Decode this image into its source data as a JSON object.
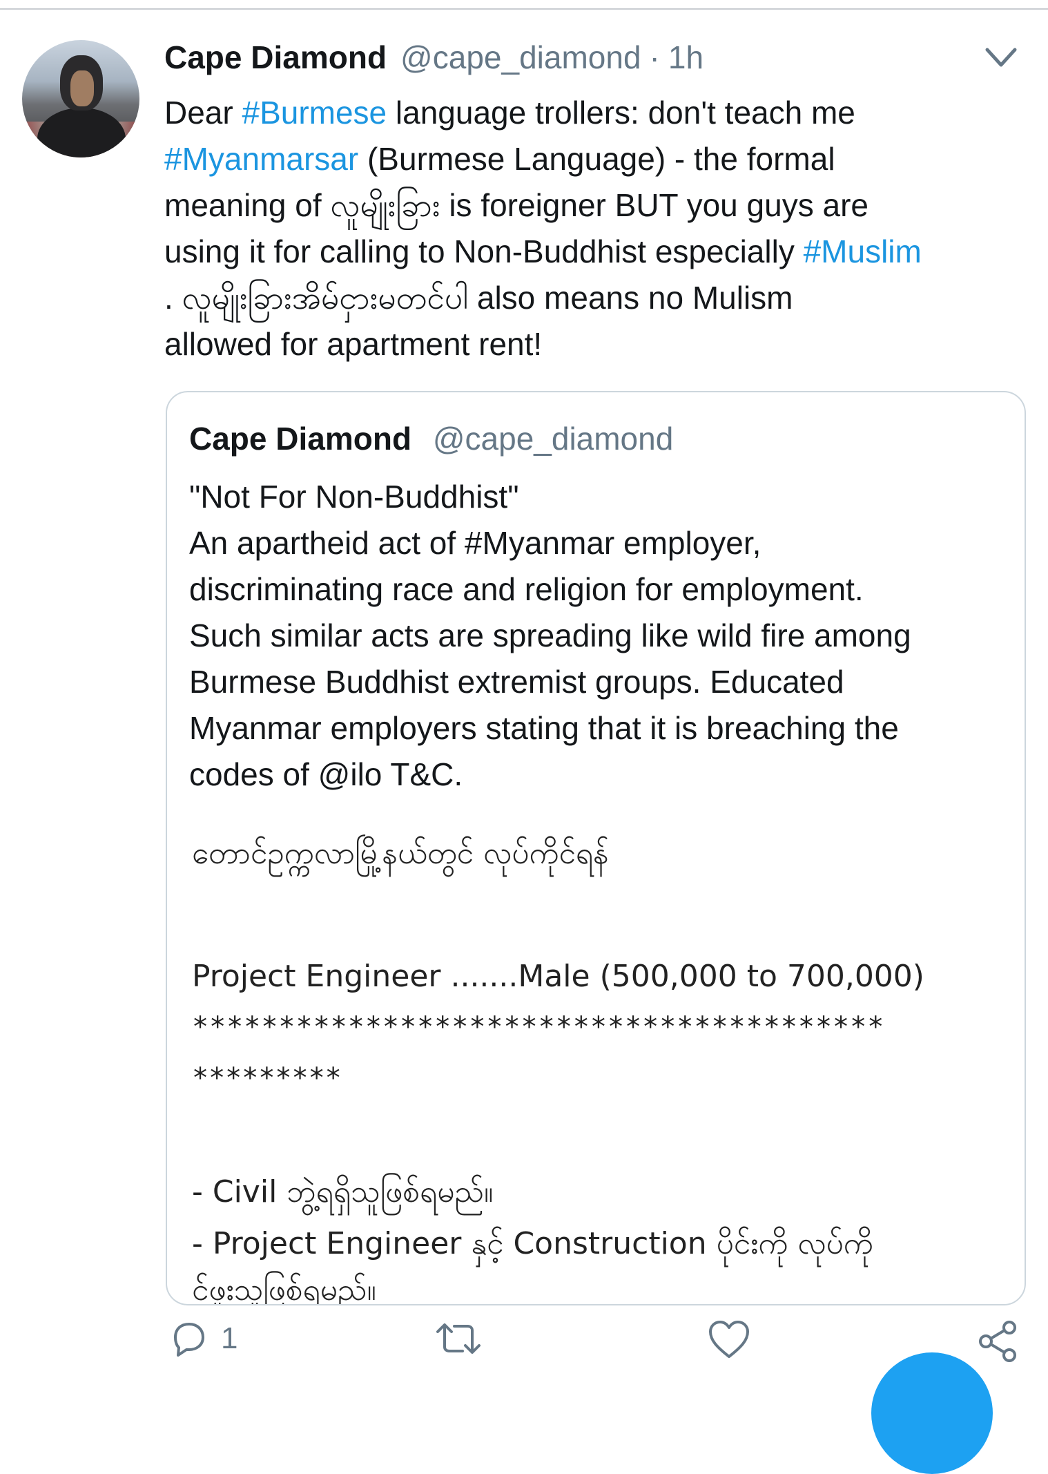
{
  "tweet": {
    "author_name": "Cape Diamond",
    "author_handle": "@cape_diamond",
    "separator": "·",
    "time": "1h",
    "lines": [
      [
        {
          "t": "Dear "
        },
        {
          "t": "#Burmese",
          "tag": true
        },
        {
          "t": " language trollers: don't teach me"
        }
      ],
      [
        {
          "t": "#Myanmarsar",
          "tag": true
        },
        {
          "t": " (Burmese Language) - the formal"
        }
      ],
      [
        {
          "t": "meaning of လူမျိုးခြား is foreigner BUT you guys are"
        }
      ],
      [
        {
          "t": "using it for calling to Non-Buddhist especially "
        },
        {
          "t": "#Muslim",
          "tag": true
        }
      ],
      [
        {
          "t": ". လူမျိုးခြားအိမ်ငှားမတင်ပါ also means no Mulism"
        }
      ],
      [
        {
          "t": "allowed for apartment rent!"
        }
      ]
    ]
  },
  "quote": {
    "author_name": "Cape Diamond",
    "author_handle": "@cape_diamond",
    "lines": [
      "\"Not For Non-Buddhist\"",
      "An apartheid act of #Myanmar employer,",
      "discriminating race and religion for employment.",
      "Such similar acts are spreading like wild fire among",
      "Burmese Buddhist extremist groups. Educated",
      "Myanmar employers stating that it is breaching the",
      "codes of @ilo T&C."
    ],
    "image": {
      "heading_myanmar": "တောင်ဥက္ကလာမြို့နယ်တွင် လုပ်ကိုင်ရန်",
      "job_line": "Project Engineer .......Male (500,000 to 700,000)",
      "stars_line1": "****************************************",
      "stars_line2": "*********",
      "req1": "- Civil ဘွဲ့ရရှိသူဖြစ်ရမည်။",
      "req2": "- Project Engineer နှင့် Construction ပိုင်းကို လုပ်ကို",
      "req3": "င်ဖူးသူဖြစ်ရမည်။"
    }
  },
  "actions": {
    "reply_count": "1"
  },
  "colors": {
    "link": "#1b95e0",
    "muted": "#657786",
    "fab": "#1da1f2"
  }
}
